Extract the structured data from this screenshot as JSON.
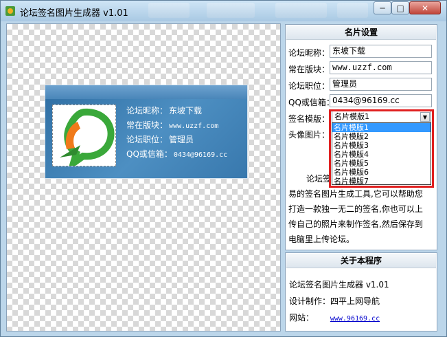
{
  "window": {
    "title": "论坛签名图片生成器 v1.01",
    "min_glyph": "─",
    "max_glyph": "□",
    "close_glyph": "✕"
  },
  "card": {
    "lines": [
      {
        "label": "论坛昵称：",
        "value": "东坡下载"
      },
      {
        "label": "常在版块：",
        "value": "www.uzzf.com"
      },
      {
        "label": "论坛职位：",
        "value": "管理员"
      },
      {
        "label": "QQ或信箱：",
        "value": "0434@96169.cc"
      }
    ]
  },
  "settings": {
    "header": "名片设置",
    "nickname_label": "论坛昵称：",
    "nickname_value": "东坡下载",
    "board_label": "常在版块：",
    "board_value": "www.uzzf.com",
    "position_label": "论坛职位：",
    "position_value": "管理员",
    "email_label": "QQ或信箱：",
    "email_value": "0434@96169.cc",
    "template_label": "签名模版：",
    "template_selected": "名片模版1",
    "avatar_label": "头像图片：",
    "templates": [
      "名片模版1",
      "名片模版2",
      "名片模版3",
      "名片模版4",
      "名片模版5",
      "名片模版6",
      "名片模版7"
    ],
    "description_lines": [
      "论坛签",
      "易的签名图片生成工具,它可以帮助您",
      "打造一款独一无二的签名,你也可以上",
      "传自己的照片来制作签名,然后保存到",
      "电脑里上传论坛。"
    ]
  },
  "about": {
    "header": "关于本程序",
    "app_name": "论坛签名图片生成器 v1.01",
    "author_label": "设计制作：",
    "author_value": "四平上网导航",
    "site_label": "网站：",
    "site_link": "www.96169.cc"
  },
  "colors": {
    "highlight_box": "#e02020",
    "selection": "#3399ff",
    "card_blue": "#2f6ea3"
  }
}
